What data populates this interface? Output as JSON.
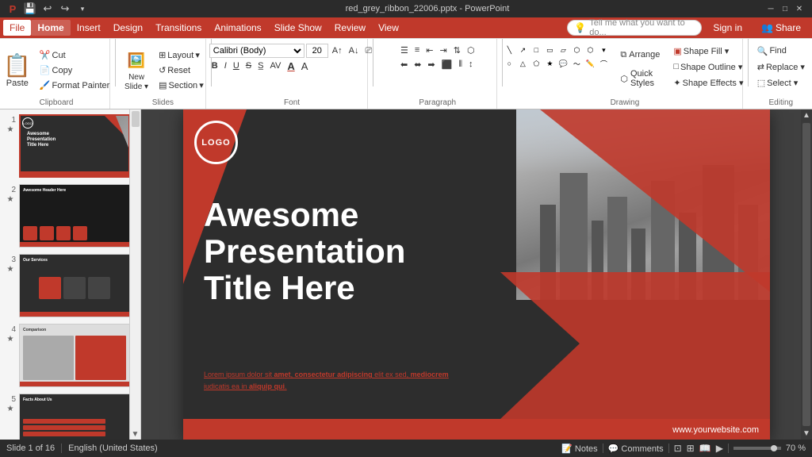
{
  "titlebar": {
    "title": "red_grey_ribbon_22006.pptx - PowerPoint",
    "undo": "↩",
    "redo": "↪",
    "save": "💾",
    "controls": [
      "─",
      "□",
      "✕"
    ]
  },
  "menubar": {
    "items": [
      "File",
      "Home",
      "Insert",
      "Design",
      "Transitions",
      "Animations",
      "Slide Show",
      "Review",
      "View"
    ]
  },
  "ribbon": {
    "clipboard_label": "Clipboard",
    "slides_label": "Slides",
    "font_label": "Font",
    "paragraph_label": "Paragraph",
    "drawing_label": "Drawing",
    "editing_label": "Editing",
    "paste_label": "Paste",
    "new_slide_label": "New\nSlide",
    "layout_label": "Layout",
    "reset_label": "Reset",
    "section_label": "Section",
    "font_name": "Calibri (Body)",
    "font_size": "20",
    "bold": "B",
    "italic": "I",
    "underline": "U",
    "strikethrough": "S",
    "arrange_label": "Arrange",
    "quick_styles_label": "Quick\nStyles",
    "shape_fill": "Shape Fill ▾",
    "shape_outline": "Shape Outline ▾",
    "shape_effects": "Shape Effects ▾",
    "find_label": "Find",
    "replace_label": "Replace ▾",
    "select_label": "Select ▾",
    "tell_me": "Tell me what you want to do...",
    "sign_in": "Sign in",
    "share": "Share",
    "effects_label": "Effects"
  },
  "slides": [
    {
      "num": "1",
      "starred": true
    },
    {
      "num": "2",
      "starred": true
    },
    {
      "num": "3",
      "starred": true
    },
    {
      "num": "4",
      "starred": true
    },
    {
      "num": "5",
      "starred": true
    }
  ],
  "slide": {
    "logo_text": "LOGO",
    "title_line1": "Awesome",
    "title_line2": "Presentation",
    "title_line3": "Title Here",
    "subtitle": "Lorem ipsum dolor sit amet, consectetur adipiscing elit ex sed, mediocrem\niudicatis ea in aliquip qui.",
    "website": "www.yourwebsite.com"
  },
  "statusbar": {
    "slide_count": "Slide 1 of 16",
    "language": "English (United States)",
    "notes_label": "Notes",
    "comments_label": "Comments",
    "zoom_level": "70 %"
  }
}
